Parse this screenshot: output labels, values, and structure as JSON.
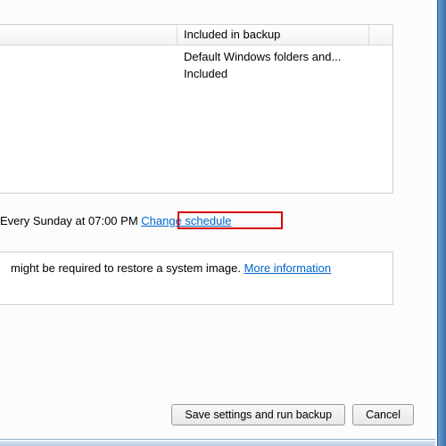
{
  "table": {
    "header": "Included in backup",
    "rows": [
      "Default Windows folders and...",
      "Included"
    ]
  },
  "schedule": {
    "text": "Every Sunday at 07:00 PM ",
    "link": "Change schedule"
  },
  "info": {
    "text": " might be required to restore a system image. ",
    "link": "More information"
  },
  "buttons": {
    "save": "Save settings and run backup",
    "cancel": "Cancel"
  }
}
